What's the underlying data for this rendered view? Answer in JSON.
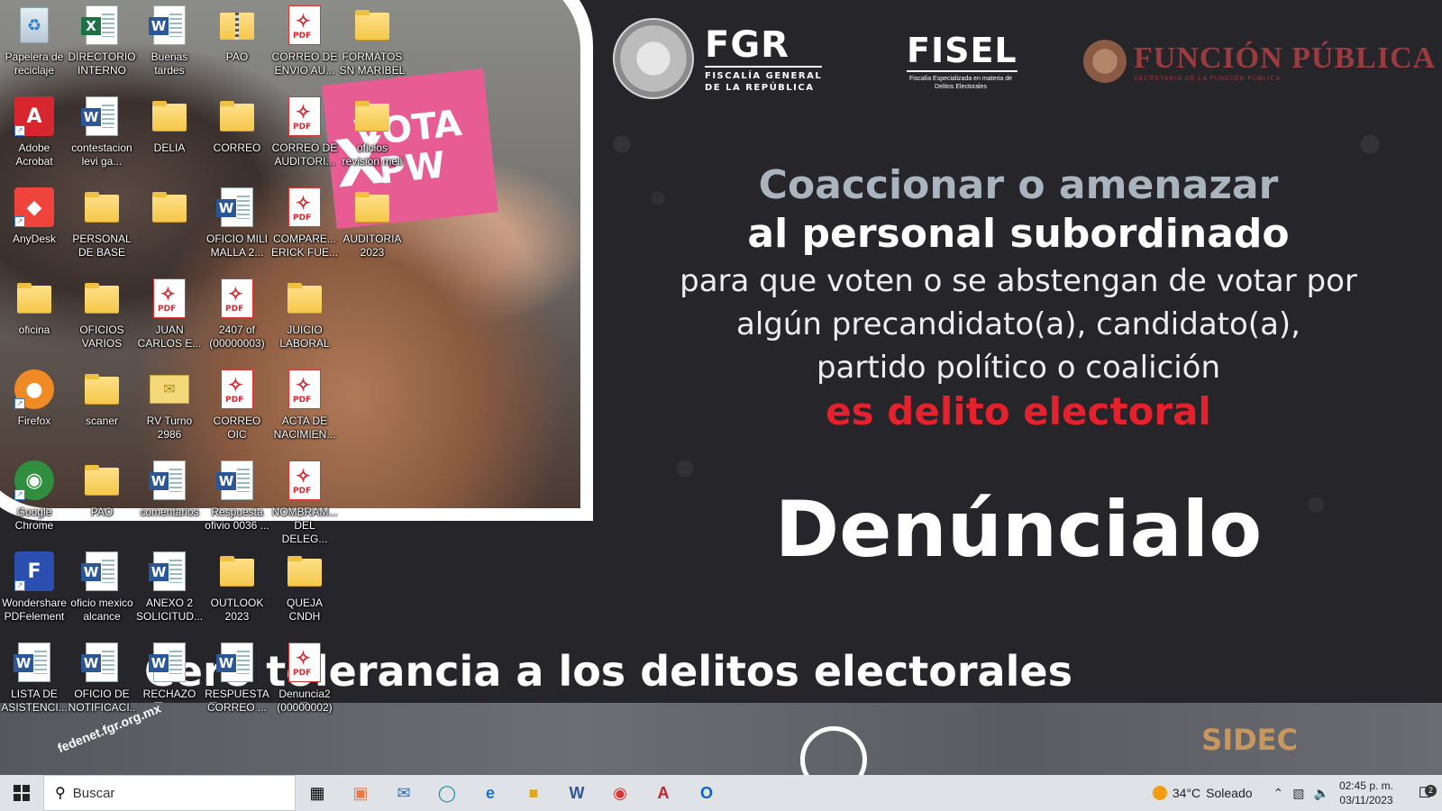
{
  "poster": {
    "fgr_title": "FGR",
    "fgr_sub1": "FISCALÍA GENERAL",
    "fgr_sub2": "DE LA REPÚBLICA",
    "seal_text": "ESTADOS UNIDOS MEXICANOS",
    "fisel_title": "FISEL",
    "fisel_sub": "Fiscalía Especializada en materia de Delitos Electorales",
    "fp_title": "FUNCIÓN PÚBLICA",
    "fp_sub": "SECRETARÍA DE LA FUNCIÓN PÚBLICA",
    "line1": "Coaccionar o amenazar",
    "line2": "al personal subordinado",
    "line3a": "para que voten o se abstengan de votar por",
    "line3b": "algún precandidato(a), candidato(a),",
    "line3c": "partido político o coalición",
    "line4": "es delito electoral",
    "line5": "Denúncialo",
    "line6": "Cero tolerancia a los delitos electorales federales.",
    "sign_text1": "VOTA",
    "sign_text2": "PW",
    "sidec": "SIDEC",
    "stamp_url": "fedenet.fgr.org.mx"
  },
  "desktop_icons": [
    {
      "label": "Papelera de reciclaje",
      "type": "recycle"
    },
    {
      "label": "DIRECTORIO INTERNO",
      "type": "excel"
    },
    {
      "label": "Buenas tardes",
      "type": "word"
    },
    {
      "label": "PAO",
      "type": "zip"
    },
    {
      "label": "CORREO DE ENVIO AU...",
      "type": "pdf"
    },
    {
      "label": "FORMATOS SN MARIBEL",
      "type": "folder"
    },
    {
      "label": "Adobe Acrobat",
      "type": "acrobat"
    },
    {
      "label": "contestacion levi ga...",
      "type": "word"
    },
    {
      "label": "DELIA",
      "type": "folder"
    },
    {
      "label": "CORREO",
      "type": "folder"
    },
    {
      "label": "CORREO DE AUDITORI...",
      "type": "pdf"
    },
    {
      "label": "oficios revision meli",
      "type": "folder"
    },
    {
      "label": "AnyDesk",
      "type": "anydesk"
    },
    {
      "label": "PERSONAL DE BASE",
      "type": "folder"
    },
    {
      "label": "",
      "type": "folder"
    },
    {
      "label": "OFICIO MILI MALLA 2...",
      "type": "word"
    },
    {
      "label": "COMPARE... ERICK FUE...",
      "type": "pdf"
    },
    {
      "label": "AUDITORIA 2023",
      "type": "folder"
    },
    {
      "label": "oficina",
      "type": "folder"
    },
    {
      "label": "OFICIOS VARIOS",
      "type": "folder"
    },
    {
      "label": "JUAN CARLOS E...",
      "type": "pdf"
    },
    {
      "label": "2407 of (00000003)",
      "type": "pdf"
    },
    {
      "label": "JUICIO LABORAL",
      "type": "folder"
    },
    {
      "label": "Firefox",
      "type": "firefox"
    },
    {
      "label": "scaner",
      "type": "folder"
    },
    {
      "label": "RV Turno 2986",
      "type": "mail"
    },
    {
      "label": "CORREO OIC",
      "type": "pdf"
    },
    {
      "label": "ACTA DE NACIMIEN...",
      "type": "pdf"
    },
    {
      "label": "Google Chrome",
      "type": "chrome"
    },
    {
      "label": "PAO",
      "type": "folder"
    },
    {
      "label": "comentarios",
      "type": "word"
    },
    {
      "label": "Respuesta ofivio 0036 ...",
      "type": "word"
    },
    {
      "label": "NOMBRAM... DEL DELEG...",
      "type": "pdf"
    },
    {
      "label": "Wondershare PDFelement",
      "type": "pdfelement"
    },
    {
      "label": "oficio mexico alcance",
      "type": "word"
    },
    {
      "label": "ANEXO 2 SOLICITUD...",
      "type": "word"
    },
    {
      "label": "OUTLOOK 2023",
      "type": "folder"
    },
    {
      "label": "QUEJA CNDH",
      "type": "folder"
    },
    {
      "label": "LISTA DE ASISTENCI...",
      "type": "word"
    },
    {
      "label": "OFICIO DE NOTIFICACI...",
      "type": "word"
    },
    {
      "label": "RECHAZO",
      "type": "word"
    },
    {
      "label": "RESPUESTA CORREO ...",
      "type": "word"
    },
    {
      "label": "Denuncia2 (00000002)",
      "type": "pdf"
    }
  ],
  "taskbar": {
    "search_placeholder": "Buscar",
    "apps": [
      "task-view",
      "microsoft-store",
      "mail",
      "edge",
      "internet-explorer",
      "file-explorer",
      "word",
      "chrome",
      "acrobat",
      "outlook"
    ],
    "weather_temp": "34°C",
    "weather_desc": "Soleado",
    "time": "02:45 p. m.",
    "date": "03/11/2023",
    "notification_count": "2"
  }
}
